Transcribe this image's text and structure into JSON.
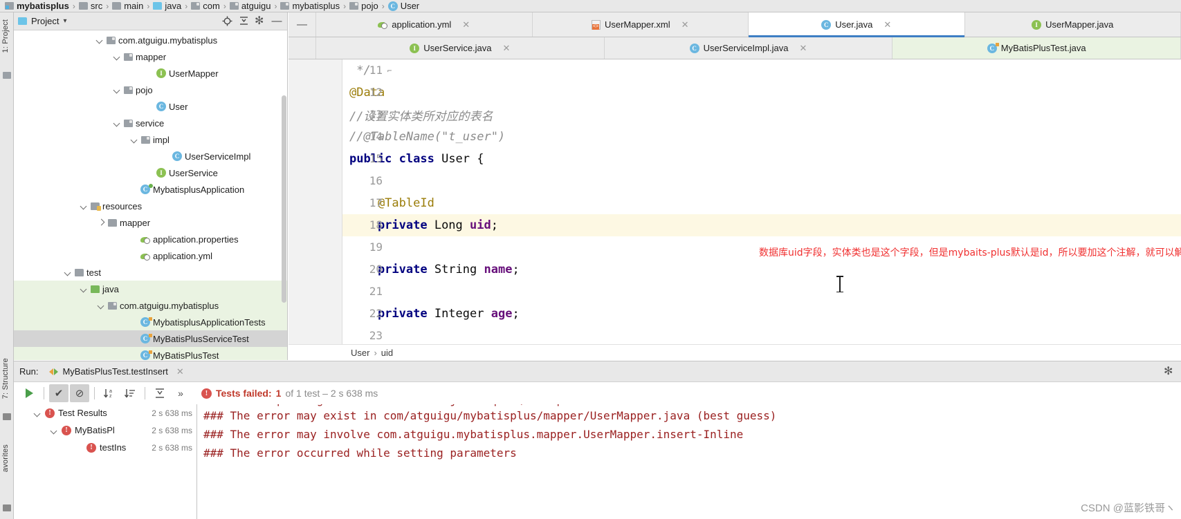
{
  "breadcrumb": {
    "items": [
      {
        "label": "mybatisplus",
        "icon": "module-icon",
        "bold": true
      },
      {
        "label": "src",
        "icon": "folder-icon"
      },
      {
        "label": "main",
        "icon": "folder-icon"
      },
      {
        "label": "java",
        "icon": "folder-blue-icon"
      },
      {
        "label": "com",
        "icon": "package-icon"
      },
      {
        "label": "atguigu",
        "icon": "package-icon"
      },
      {
        "label": "mybatisplus",
        "icon": "package-icon"
      },
      {
        "label": "pojo",
        "icon": "package-icon"
      },
      {
        "label": "User",
        "icon": "class-icon"
      }
    ],
    "separator": "›"
  },
  "left_strip": {
    "project_tab": "1: Project",
    "structure_tab": "7: Structure",
    "favorites_tab": "avorites"
  },
  "project_panel": {
    "title": "Project",
    "dropdown_caret": "▾",
    "tree": [
      {
        "label": "com.atguigu.mybatisplus",
        "indent": 118,
        "chev": "down",
        "icon": "package-icon",
        "state": "normal"
      },
      {
        "label": "mapper",
        "indent": 143,
        "chev": "down",
        "icon": "package-icon",
        "state": "normal"
      },
      {
        "label": "UserMapper",
        "indent": 190,
        "chev": "none",
        "icon": "interface-icon",
        "state": "normal"
      },
      {
        "label": "pojo",
        "indent": 143,
        "chev": "down",
        "icon": "package-icon",
        "state": "normal"
      },
      {
        "label": "User",
        "indent": 190,
        "chev": "none",
        "icon": "class-icon",
        "state": "normal"
      },
      {
        "label": "service",
        "indent": 143,
        "chev": "down",
        "icon": "package-icon",
        "state": "normal"
      },
      {
        "label": "impl",
        "indent": 168,
        "chev": "down",
        "icon": "package-icon",
        "state": "normal"
      },
      {
        "label": "UserServiceImpl",
        "indent": 213,
        "chev": "none",
        "icon": "class-icon",
        "state": "normal"
      },
      {
        "label": "UserService",
        "indent": 190,
        "chev": "none",
        "icon": "interface-icon",
        "state": "normal"
      },
      {
        "label": "MybatisplusApplication",
        "indent": 167,
        "chev": "none",
        "icon": "spring-class-icon",
        "state": "normal"
      },
      {
        "label": "resources",
        "indent": 95,
        "chev": "down",
        "icon": "resources-folder-icon",
        "state": "normal"
      },
      {
        "label": "mapper",
        "indent": 120,
        "chev": "right",
        "icon": "folder-icon",
        "state": "normal"
      },
      {
        "label": "application.properties",
        "indent": 167,
        "chev": "none",
        "icon": "yml-icon",
        "state": "normal"
      },
      {
        "label": "application.yml",
        "indent": 167,
        "chev": "none",
        "icon": "yml-icon",
        "state": "normal"
      },
      {
        "label": "test",
        "indent": 72,
        "chev": "down",
        "icon": "folder-icon",
        "state": "normal"
      },
      {
        "label": "java",
        "indent": 95,
        "chev": "down",
        "icon": "folder-green-icon",
        "state": "green"
      },
      {
        "label": "com.atguigu.mybatisplus",
        "indent": 120,
        "chev": "down",
        "icon": "package-icon",
        "state": "green"
      },
      {
        "label": "MybatisplusApplicationTests",
        "indent": 167,
        "chev": "none",
        "icon": "test-class-icon",
        "state": "green"
      },
      {
        "label": "MyBatisPlusServiceTest",
        "indent": 167,
        "chev": "none",
        "icon": "test-class-icon",
        "state": "selected"
      },
      {
        "label": "MyBatisPlusTest",
        "indent": 167,
        "chev": "none",
        "icon": "test-class-icon",
        "state": "green"
      }
    ]
  },
  "editor_tabs": {
    "row1": [
      {
        "label": "application.yml",
        "icon": "yml-icon",
        "active": false,
        "close": "✕"
      },
      {
        "label": "UserMapper.xml",
        "icon": "xml-icon",
        "active": false,
        "close": "✕"
      },
      {
        "label": "User.java",
        "icon": "class-icon",
        "active": true,
        "close": "✕"
      },
      {
        "label": "UserMapper.java",
        "icon": "interface-icon",
        "active": false,
        "close": ""
      }
    ],
    "row2": [
      {
        "label": "UserService.java",
        "icon": "interface-icon",
        "active": false,
        "close": "✕"
      },
      {
        "label": "UserServiceImpl.java",
        "icon": "class-icon",
        "active": false,
        "close": "✕"
      },
      {
        "label": "MyBatisPlusTest.java",
        "icon": "test-class-icon",
        "active": false,
        "close": ""
      }
    ],
    "collapse_button": "—"
  },
  "code": {
    "lines": [
      {
        "num": "11",
        "fold": "⌐",
        "tokens": [
          {
            "t": " */",
            "c": "k-cmt"
          }
        ]
      },
      {
        "num": "12",
        "fold": "",
        "tokens": [
          {
            "t": "@Data",
            "c": "k-ann"
          }
        ]
      },
      {
        "num": "13",
        "fold": "",
        "tokens": [
          {
            "t": "//设置实体类所对应的表名",
            "c": "k-cmt"
          }
        ]
      },
      {
        "num": "14",
        "fold": "",
        "tokens": [
          {
            "t": "//@TableName(\"t_user\")",
            "c": "k-cmt"
          }
        ]
      },
      {
        "num": "15",
        "fold": "",
        "tokens": [
          {
            "t": "public ",
            "c": "k-kw"
          },
          {
            "t": "class ",
            "c": "k-kw"
          },
          {
            "t": "User {",
            "c": "k-txt"
          }
        ]
      },
      {
        "num": "16",
        "fold": "",
        "tokens": []
      },
      {
        "num": "17",
        "fold": "",
        "tokens": [
          {
            "t": "    @TableId",
            "c": "k-ann"
          }
        ]
      },
      {
        "num": "18",
        "fold": "",
        "highlight": true,
        "tokens": [
          {
            "t": "    private ",
            "c": "k-kw"
          },
          {
            "t": "Long ",
            "c": "k-txt"
          },
          {
            "t": "uid",
            "c": "k-fld"
          },
          {
            "t": ";",
            "c": "k-txt"
          }
        ]
      },
      {
        "num": "19",
        "fold": "",
        "tokens": []
      },
      {
        "num": "20",
        "fold": "",
        "tokens": [
          {
            "t": "    private ",
            "c": "k-kw"
          },
          {
            "t": "String ",
            "c": "k-txt"
          },
          {
            "t": "name",
            "c": "k-fld"
          },
          {
            "t": ";",
            "c": "k-txt"
          }
        ]
      },
      {
        "num": "21",
        "fold": "",
        "tokens": []
      },
      {
        "num": "22",
        "fold": "",
        "tokens": [
          {
            "t": "    private ",
            "c": "k-kw"
          },
          {
            "t": "Integer ",
            "c": "k-txt"
          },
          {
            "t": "age",
            "c": "k-fld"
          },
          {
            "t": ";",
            "c": "k-txt"
          }
        ]
      },
      {
        "num": "23",
        "fold": "",
        "tokens": []
      }
    ],
    "annotation": "数据库uid字段，实体类也是这个字段，但是mybaits-plus默认是id，所以要加这个注解，就可以解决",
    "annotation_color": "#f03030"
  },
  "editor_breadcrumb": {
    "items": [
      "User",
      "uid"
    ],
    "separator": "›"
  },
  "run_panel": {
    "label": "Run:",
    "config_name": "MyBatisPlusTest.testInsert",
    "close": "✕",
    "settings_icon": "gear-icon",
    "toolbar": {
      "rerun": "play-icon",
      "show_passed": "✔",
      "show_ignored": "⊘",
      "sort_alpha": "↓a\nz",
      "sort_duration": "↓",
      "expand": "⤓",
      "more": "»"
    },
    "status": {
      "failed_label": "Tests failed:",
      "failed_count": "1",
      "rest": "of 1 test – 2 s 638 ms"
    },
    "tree": [
      {
        "label": "Test Results",
        "time": "2 s 638 ms",
        "indent": 28,
        "chev": "down",
        "icon": "error-icon"
      },
      {
        "label": "MyBatisPl",
        "time": "2 s 638 ms",
        "indent": 52,
        "chev": "down",
        "icon": "error-icon"
      },
      {
        "label": "testIns",
        "time": "2 s 638 ms",
        "indent": 88,
        "chev": "none",
        "icon": "error-icon"
      }
    ],
    "console": [
      "### Error updating database.  Cause: java.sql.SQLException: Field 'uid' doesn't have a default value",
      "### The error may exist in com/atguigu/mybatisplus/mapper/UserMapper.java (best guess)",
      "### The error may involve com.atguigu.mybatisplus.mapper.UserMapper.insert-Inline",
      "### The error occurred while setting parameters"
    ]
  },
  "watermark": "CSDN @蓝影铁哥ヽ"
}
